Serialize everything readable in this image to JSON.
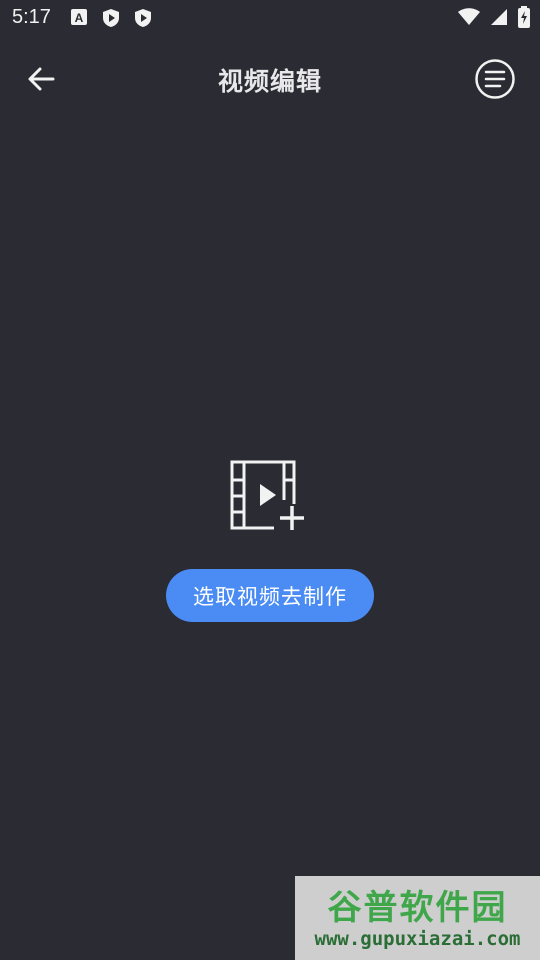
{
  "status_bar": {
    "time": "5:17",
    "left_icons": [
      "a-icon",
      "shield-icon",
      "shield-icon"
    ],
    "right_icons": [
      "wifi-icon",
      "signal-icon",
      "battery-icon"
    ]
  },
  "header": {
    "title": "视频编辑",
    "back_icon": "arrow-left-icon",
    "menu_icon": "menu-icon"
  },
  "main": {
    "illustration_icon": "video-add-icon",
    "pick_button_label": "选取视频去制作"
  },
  "watermark": {
    "title": "谷普软件园",
    "url": "www.gupuxiazai.com"
  },
  "colors": {
    "background": "#2b2b33",
    "accent": "#4a8cf4",
    "text": "#e6e6e8"
  }
}
